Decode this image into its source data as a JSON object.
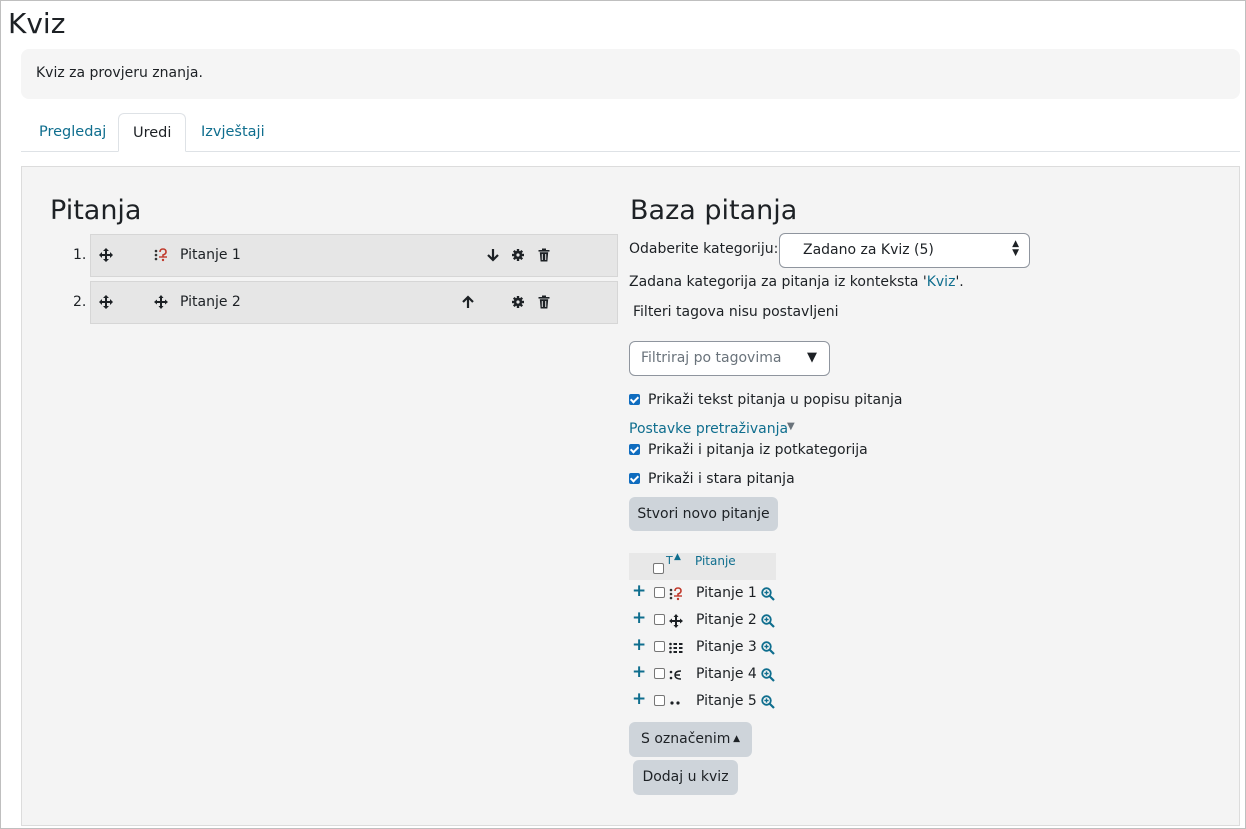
{
  "page": {
    "title": "Kviz",
    "intro": "Kviz za provjeru znanja.",
    "tabs": [
      {
        "label": "Pregledaj"
      },
      {
        "label": "Uredi"
      },
      {
        "label": "Izvještaji"
      }
    ]
  },
  "questions": {
    "heading": "Pitanja",
    "slots": [
      {
        "number": "1.",
        "name": "Pitanje 1",
        "type_icon": "multichoice-icon",
        "reorder_icon": "arrow-down-icon"
      },
      {
        "number": "2.",
        "name": "Pitanje 2",
        "type_icon": "drag-drop-icon",
        "reorder_icon": "arrow-up-icon"
      }
    ]
  },
  "bank": {
    "heading": "Baza pitanja",
    "category_label": "Odaberite kategoriju:",
    "category_value": "Zadano za Kviz (5)",
    "category_desc_prefix": "Zadana kategorija za pitanja iz konteksta '",
    "category_desc_link": "Kviz",
    "category_desc_suffix": "'.",
    "tag_filter_status": "Filteri tagova nisu postavljeni",
    "tag_filter_placeholder": "Filtriraj po tagovima",
    "show_text_label": "Prikaži tekst pitanja u popisu pitanja",
    "search_settings_label": "Postavke pretraživanja",
    "subcategories_label": "Prikaži i pitanja iz potkategorija",
    "old_questions_label": "Prikaži i stara pitanja",
    "create_button": "Stvori novo pitanje",
    "table": {
      "type_header": "T",
      "name_header": "Pitanje",
      "rows": [
        {
          "name": "Pitanje 1",
          "type_icon": "multichoice-icon"
        },
        {
          "name": "Pitanje 2",
          "type_icon": "drag-drop-icon"
        },
        {
          "name": "Pitanje 3",
          "type_icon": "matching-icon"
        },
        {
          "name": "Pitanje 4",
          "type_icon": "multianswer-icon"
        },
        {
          "name": "Pitanje 5",
          "type_icon": "shortanswer-icon"
        }
      ]
    },
    "with_selected_button": "S označenim",
    "add_button": "Dodaj u kviz"
  },
  "colors": {
    "link": "#0f6e8e",
    "checkbox": "#0f6cbf",
    "button": "#ced4da",
    "slot_bg": "#e6e6e6"
  }
}
